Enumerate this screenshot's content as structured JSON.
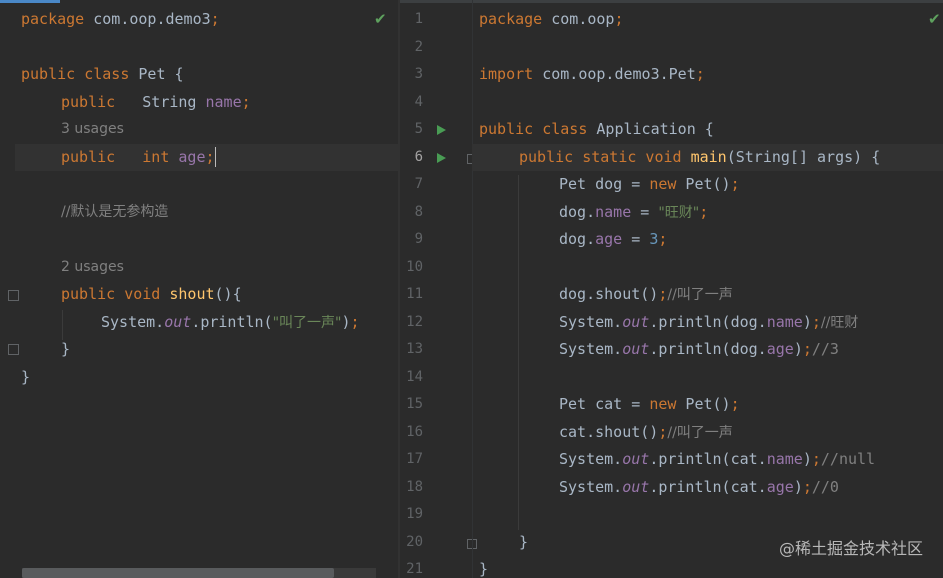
{
  "left_editor": {
    "status_icon": "checkmark-icon",
    "lines": {
      "l1_kw": "package",
      "l1_rest": " com.oop.demo3",
      "l3_kw": "public class",
      "l3_rest": " Pet {",
      "l4_kw": "public",
      "l4_type": "   String ",
      "l4_field": "name",
      "l5_hint": "3 usages",
      "l6_kw": "public",
      "l6_kw2": "   int ",
      "l6_field": "age",
      "l8_comment": "//默认是无参构造",
      "l10_hint": "2 usages",
      "l11_kw": "public void",
      "l11_fn": "shout",
      "l11_rest": "(){",
      "l12_a": "System.",
      "l12_out": "out",
      "l12_b": ".println(",
      "l12_str": "\"叫了一声\"",
      "l13": "}",
      "l14": "}"
    }
  },
  "right_editor": {
    "status_icon": "checkmark-icon",
    "line_numbers": [
      "1",
      "2",
      "3",
      "4",
      "5",
      "6",
      "7",
      "8",
      "9",
      "10",
      "11",
      "12",
      "13",
      "14",
      "15",
      "16",
      "17",
      "18",
      "19",
      "20",
      "21"
    ],
    "lines": {
      "l1_kw": "package",
      "l1_rest": " com.oop",
      "l3_kw": "import",
      "l3_rest": " com.oop.demo3.Pet",
      "l5_kw": "public class",
      "l5_rest": " Application {",
      "l6_kw": "public static void",
      "l6_fn": "main",
      "l6_rest": "(String[] args) {",
      "l7_a": "Pet dog = ",
      "l7_kw": "new",
      "l7_b": " Pet()",
      "l8_a": "dog.",
      "l8_fld": "name",
      "l8_b": " = ",
      "l8_str": "\"旺财\"",
      "l9_a": "dog.",
      "l9_fld": "age",
      "l9_b": " = ",
      "l9_num": "3",
      "l11_a": "dog.shout()",
      "l11_cm": "//叫了一声",
      "l12_a": "System.",
      "l12_out": "out",
      "l12_b": ".println(dog.",
      "l12_fld": "name",
      "l12_c": ")",
      "l12_cm": "//旺财",
      "l13_a": "System.",
      "l13_out": "out",
      "l13_b": ".println(dog.",
      "l13_fld": "age",
      "l13_c": ")",
      "l13_cm": "//3",
      "l15_a": "Pet cat = ",
      "l15_kw": "new",
      "l15_b": " Pet()",
      "l16_a": "cat.shout()",
      "l16_cm": "//叫了一声",
      "l17_a": "System.",
      "l17_out": "out",
      "l17_b": ".println(cat.",
      "l17_fld": "name",
      "l17_c": ")",
      "l17_cm": "//null",
      "l18_a": "System.",
      "l18_out": "out",
      "l18_b": ".println(cat.",
      "l18_fld": "age",
      "l18_c": ")",
      "l18_cm": "//0",
      "l20": "}",
      "l21": "}"
    }
  },
  "punct": {
    "semi": ";",
    "space": " "
  },
  "watermark": "@稀土掘金技术社区"
}
